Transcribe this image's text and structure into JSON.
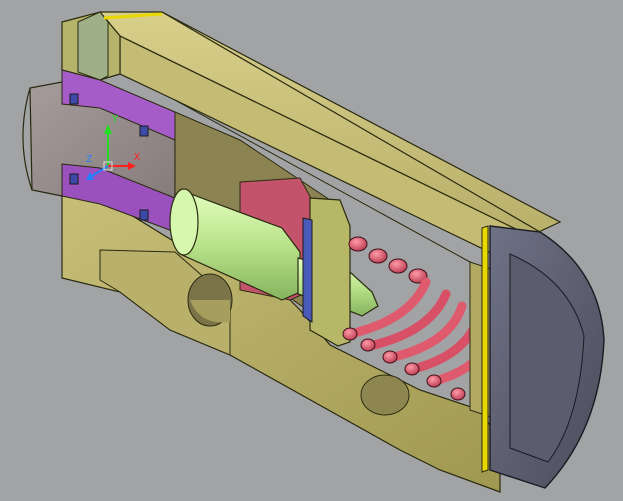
{
  "viewport": {
    "background": "#a2a3a5",
    "visual_style": "shaded-section-view"
  },
  "ucs_icon": {
    "x_axis_label": "X",
    "y_axis_label": "Y",
    "z_axis_label": "Z",
    "x_color": "#ff2020",
    "y_color": "#22dd22",
    "z_color": "#2080ff",
    "origin_icon": "ucs-origin-icon"
  },
  "model_colors": {
    "housing": "#c9c07a",
    "housing_dark": "#8f8845",
    "end_cap": "#5e6070",
    "piston_rod": "#c8ee9a",
    "shaft": "#978f8e",
    "bushing": "#a45cc8",
    "seat": "#c2526a",
    "flange": "#b7b768",
    "plate": "#4a5ab8",
    "spring": "#e45a70",
    "gasket": "#e8d800",
    "sleeve": "#a7b88a"
  }
}
